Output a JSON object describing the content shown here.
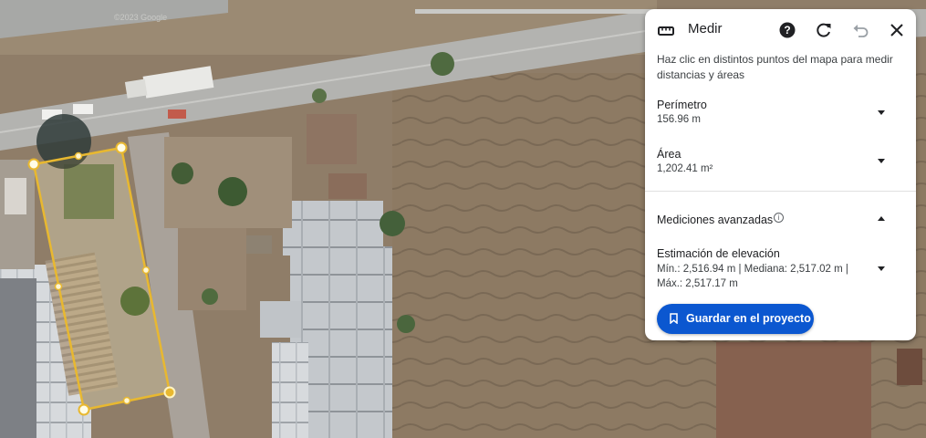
{
  "map": {
    "type": "satellite-imagery",
    "watermark": "©2023 Google",
    "measure_shape_color": "#e8b830"
  },
  "panel": {
    "icon": "ruler-icon",
    "title": "Medir",
    "header_buttons": [
      "help-icon",
      "refresh-icon",
      "undo-icon",
      "close-icon"
    ],
    "instructions": "Haz clic en distintos puntos del mapa para medir distancias y áreas",
    "perimeter": {
      "label": "Perímetro",
      "value": "156.96 m"
    },
    "area": {
      "label": "Área",
      "value": "1,202.41 m²"
    },
    "advanced": {
      "label": "Mediciones avanzadas",
      "info_icon": "info-icon",
      "expanded": true
    },
    "elevation": {
      "label": "Estimación de elevación",
      "value": "Mín.: 2,516.94 m | Mediana: 2,517.02 m | Máx.: 2,517.17 m"
    },
    "save_button": {
      "label": "Guardar en el proyecto",
      "icon": "bookmark-icon",
      "color": "#0b57d0"
    }
  }
}
